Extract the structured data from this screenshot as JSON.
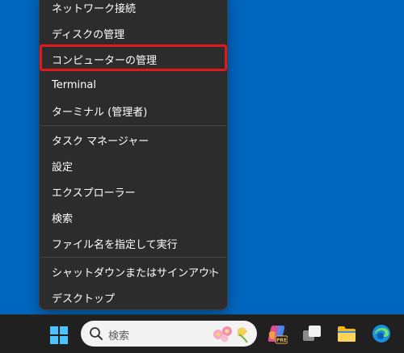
{
  "context_menu": {
    "items": [
      {
        "label": "ネットワーク接続"
      },
      {
        "label": "ディスクの管理"
      },
      {
        "label": "コンピューターの管理"
      },
      {
        "label": "Terminal"
      },
      {
        "label": "ターミナル (管理者)"
      },
      {
        "label": "タスク マネージャー"
      },
      {
        "label": "設定"
      },
      {
        "label": "エクスプローラー"
      },
      {
        "label": "検索"
      },
      {
        "label": "ファイル名を指定して実行"
      },
      {
        "label": "シャットダウンまたはサインアウト",
        "submenu_icon": "chevron-right-icon"
      },
      {
        "label": "デスクトップ"
      }
    ],
    "highlighted_item": "コンピューターの管理",
    "highlight_color": "#e0191c"
  },
  "taskbar": {
    "search": {
      "placeholder": "検索",
      "icon": "search-icon"
    },
    "icons": [
      "windows-start-icon",
      "copilot-pre-icon",
      "task-view-icon",
      "file-explorer-icon",
      "edge-icon"
    ],
    "copilot_badge": "PRE"
  },
  "colors": {
    "desktop": "#0067c0",
    "menu_bg": "#2c2c2c",
    "taskbar_bg": "#202020",
    "accent": "#4cc2ff"
  }
}
